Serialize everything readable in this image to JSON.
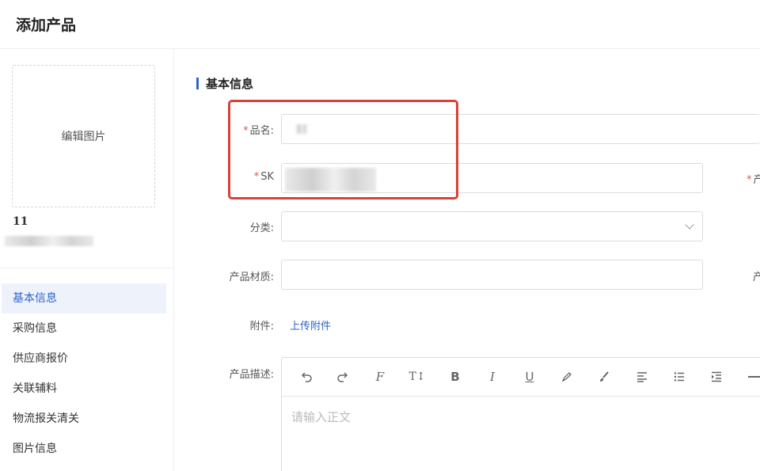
{
  "header": {
    "title": "添加产品"
  },
  "sidebar": {
    "image_label": "编辑图片",
    "product_id": "11",
    "nav": [
      {
        "label": "基本信息",
        "active": true
      },
      {
        "label": "采购信息"
      },
      {
        "label": "供应商报价"
      },
      {
        "label": "关联辅料"
      },
      {
        "label": "物流报关清关"
      },
      {
        "label": "图片信息"
      }
    ]
  },
  "main": {
    "section_title": "基本信息",
    "fields": {
      "name_label": "品名:",
      "sku_label": "SK",
      "category_label": "分类:",
      "material_label": "产品材质:",
      "attachment_label": "附件:",
      "upload_text": "上传附件",
      "description_label": "产品描述:",
      "right_col_partial_1": "产",
      "right_col_partial_3": "产"
    },
    "editor": {
      "placeholder": "请输入正文",
      "toolbar": [
        "undo-icon",
        "redo-icon",
        "clear-format-icon",
        "font-size-icon",
        "bold-icon",
        "italic-icon",
        "underline-icon",
        "highlight-icon",
        "brush-icon",
        "align-left-icon",
        "list-icon",
        "indent-icon",
        "divider-icon"
      ]
    }
  },
  "colors": {
    "accent": "#2e63c9",
    "required": "#e25555",
    "highlight_box": "#d9413a"
  }
}
